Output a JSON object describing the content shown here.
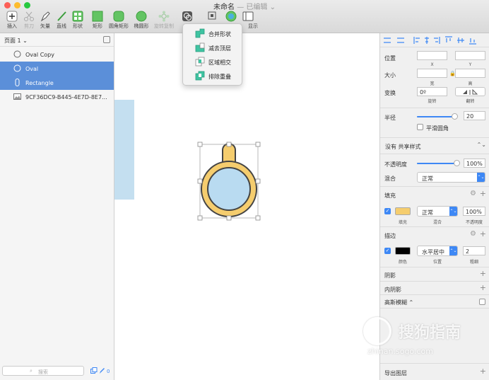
{
  "window": {
    "title": "未命名",
    "edited": "— 已编辑 ⌄"
  },
  "toolbar": {
    "items": [
      {
        "label": "插入"
      },
      {
        "label": "剪刀"
      },
      {
        "label": "矢量"
      },
      {
        "label": "直线"
      },
      {
        "label": "形状"
      },
      {
        "label": "矩形"
      },
      {
        "label": "圆角矩形"
      },
      {
        "label": "椭圆形"
      },
      {
        "label": "旋转复制"
      },
      {
        "label": "合"
      },
      {
        "label": "显示"
      }
    ]
  },
  "combine_menu": {
    "items": [
      {
        "label": "合并形状"
      },
      {
        "label": "减去顶层"
      },
      {
        "label": "区域相交"
      },
      {
        "label": "排除重叠"
      }
    ]
  },
  "layers": {
    "page_label": "页面 1 ⌄",
    "items": [
      {
        "name": "Oval Copy",
        "selected": false
      },
      {
        "name": "Oval",
        "selected": true
      },
      {
        "name": "Rectangle",
        "selected": true
      },
      {
        "name": "9CF36DC9-B445-4E7D-8E7...",
        "selected": false
      }
    ],
    "search_placeholder": "搜索",
    "footer_count": "0"
  },
  "inspector": {
    "position": {
      "label": "位置",
      "x_label": "X",
      "y_label": "Y",
      "x": "",
      "y": ""
    },
    "size": {
      "label": "大小",
      "w_label": "宽",
      "h_label": "高",
      "w": "",
      "h": ""
    },
    "transform": {
      "label": "变换",
      "rotation": "0º",
      "rotate_label": "旋转",
      "flip_label": "翻转"
    },
    "radius": {
      "label": "半径",
      "value": "20",
      "smooth_label": "平滑圆角",
      "slider_fraction": 0.95
    },
    "shared_style": "没有 共享样式",
    "opacity": {
      "label": "不透明度",
      "value": "100%",
      "slider_fraction": 1.0
    },
    "blend": {
      "label": "混合",
      "value": "正常"
    },
    "fill": {
      "title": "填充",
      "color": "#f5cd6e",
      "color_label": "填充",
      "blend": "正常",
      "blend_label": "混合",
      "opacity": "100%",
      "opacity_label": "不透明度"
    },
    "border": {
      "title": "描边",
      "color": "#000000",
      "color_label": "颜色",
      "position": "水平居中",
      "position_label": "位置",
      "width": "2",
      "width_label": "粗细"
    },
    "shadow": {
      "title": "阴影"
    },
    "inner_shadow": {
      "title": "内阴影"
    },
    "blur": {
      "title": "高斯模糊 ⌃"
    },
    "export": {
      "title": "导出图层"
    }
  },
  "watermark": {
    "text": "搜狗指南",
    "url": "zhinan.sogo.com"
  },
  "colors": {
    "selection": "#5b8fd9",
    "accent": "#3e88f5",
    "shape_fill": "#f5cd6e",
    "shape_inner": "#b9dbf1",
    "shape_stroke": "#444444"
  }
}
